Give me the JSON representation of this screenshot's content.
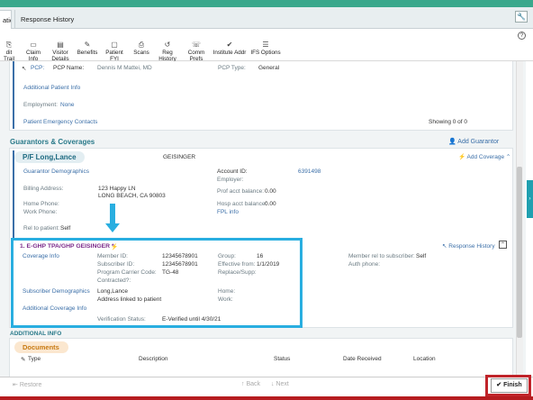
{
  "tabs": {
    "active": "ation",
    "other": "Response History"
  },
  "help_icon": "?",
  "toolbar": [
    {
      "icon": "trail-icon",
      "glyph": "⎘",
      "label": "dit Trail"
    },
    {
      "icon": "claim-icon",
      "glyph": "▭",
      "label": "Claim Info"
    },
    {
      "icon": "visitor-icon",
      "glyph": "▤",
      "label": "Visitor Details"
    },
    {
      "icon": "benefits-icon",
      "glyph": "✎",
      "label": "Benefits"
    },
    {
      "icon": "fyi-icon",
      "glyph": "▢",
      "label": "Patient FYI"
    },
    {
      "icon": "scans-icon",
      "glyph": "⎙",
      "label": "Scans"
    },
    {
      "icon": "reg-history-icon",
      "glyph": "↺",
      "label": "Reg History"
    },
    {
      "icon": "comm-prefs-icon",
      "glyph": "☏",
      "label": "Comm Prefs"
    },
    {
      "icon": "institute-icon",
      "glyph": "✔",
      "label": "Institute Addr"
    },
    {
      "icon": "ifs-icon",
      "glyph": "☰",
      "label": "IFS Options"
    }
  ],
  "pcp": {
    "pcp_label": "PCP:",
    "name_label": "PCP Name:",
    "name_value": "Dennis M Mattei, MD",
    "type_label": "PCP Type:",
    "type_value": "General",
    "additional_link": "Additional Patient Info",
    "employment_label": "Employment:",
    "employment_value": "None",
    "emergency_link": "Patient Emergency Contacts",
    "showing": "Showing 0 of 0"
  },
  "guarantors": {
    "title": "Guarantors & Coverages",
    "add_guarantor": "Add Guarantor",
    "name": "P/F Long,Lance",
    "payer": "GEISINGER",
    "add_coverage": "Add Coverage",
    "demographics_link": "Guarantor Demographics",
    "account_id_label": "Account ID:",
    "account_id_value": "6391498",
    "employer_label": "Employer:",
    "billing_label": "Billing Address:",
    "billing_line1": "123 Happy LN",
    "billing_line2": "LONG BEACH, CA 90803",
    "prof_label": "Prof acct balance:",
    "prof_value": "0.00",
    "home_phone_label": "Home Phone:",
    "work_phone_label": "Work Phone:",
    "hosp_label": "Hosp acct balance:",
    "hosp_value": "0.00",
    "fpl_link": "FPL info",
    "rel_label": "Rel to patient:",
    "rel_value": "Self"
  },
  "coverage": {
    "title": "1. E-GHP TPA/GHP GEISINGER *",
    "response_history": "Response History",
    "coverage_info_link": "Coverage Info",
    "member_id_label": "Member ID:",
    "member_id_value": "12345678901",
    "subscriber_id_label": "Subscriber ID:",
    "subscriber_id_value": "12345678901",
    "carrier_code_label": "Program Carrier Code:",
    "carrier_code_value": "TG-48",
    "contracted_label": "Contracted?:",
    "group_label": "Group:",
    "group_value": "16",
    "effective_label": "Effective from:",
    "effective_value": "1/1/2019",
    "replace_label": "Replace/Supp:",
    "member_rel_label": "Member rel to subscriber:",
    "member_rel_value": "Self",
    "auth_phone_label": "Auth phone:",
    "subscriber_demographics_link": "Subscriber Demographics",
    "subscriber_name": "Long,Lance",
    "address_note": "Address linked to patient",
    "home_label": "Home:",
    "work_label": "Work:",
    "additional_coverage_link": "Additional Coverage Info",
    "verification_label": "Verification Status:",
    "verification_value": "E-Verified until 4/30/21"
  },
  "additional_info": {
    "title": "ADDITIONAL INFO",
    "documents": "Documents",
    "columns": [
      "Type",
      "Description",
      "Status",
      "Date Received",
      "Location"
    ]
  },
  "bottom": {
    "restore": "Restore",
    "back": "Back",
    "next": "Next",
    "finish": "Finish"
  },
  "colors": {
    "accent": "#3aa88c",
    "highlight": "#29aee0",
    "finish_outline": "#c0242a"
  }
}
